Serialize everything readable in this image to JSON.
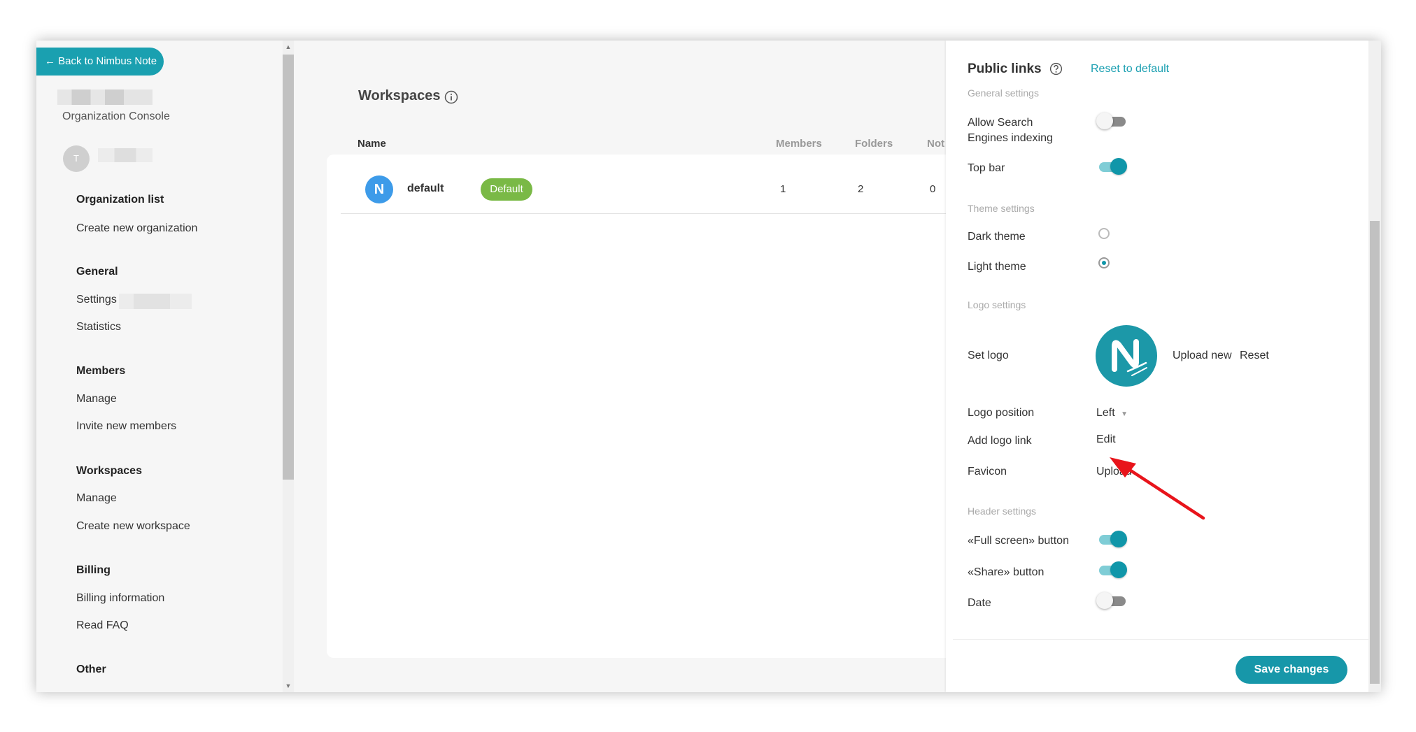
{
  "sidebar": {
    "back_label": "Back to Nimbus Note",
    "console_label": "Organization Console",
    "avatar_initial": "T",
    "sections": [
      {
        "title": "Organization list",
        "items": [
          "Create new organization"
        ]
      },
      {
        "title": "General",
        "items": [
          "Settings",
          "Statistics"
        ]
      },
      {
        "title": "Members",
        "items": [
          "Manage",
          "Invite new members"
        ]
      },
      {
        "title": "Workspaces",
        "items": [
          "Manage",
          "Create new workspace"
        ]
      },
      {
        "title": "Billing",
        "items": [
          "Billing information",
          "Read FAQ"
        ]
      },
      {
        "title": "Other",
        "items": []
      }
    ]
  },
  "main": {
    "title": "Workspaces",
    "columns": {
      "name": "Name",
      "members": "Members",
      "folders": "Folders",
      "notes": "Not"
    },
    "rows": [
      {
        "initial": "N",
        "name": "default",
        "badge": "Default",
        "members": "1",
        "folders": "2",
        "notes": "0"
      }
    ]
  },
  "panel": {
    "title": "Public links",
    "reset_label": "Reset to default",
    "general_settings": "General settings",
    "allow_search_line1": "Allow Search",
    "allow_search_line2": "Engines indexing",
    "top_bar": "Top bar",
    "theme_settings": "Theme settings",
    "dark_theme": "Dark theme",
    "light_theme": "Light theme",
    "logo_settings": "Logo settings",
    "set_logo": "Set logo",
    "upload_new": "Upload new",
    "reset": "Reset",
    "logo_position": "Logo position",
    "logo_position_value": "Left",
    "add_logo_link": "Add logo link",
    "edit": "Edit",
    "favicon": "Favicon",
    "upload": "Upload",
    "header_settings": "Header settings",
    "full_screen_button": "«Full screen» button",
    "share_button": "«Share» button",
    "date": "Date",
    "save_label": "Save changes",
    "toggles": {
      "allow_search": false,
      "top_bar": true,
      "full_screen": true,
      "share": true,
      "date": false
    },
    "theme_selected": "light"
  },
  "colors": {
    "accent": "#1a9fb1",
    "badge": "#7ab946",
    "annotation_arrow": "#e8141b"
  },
  "icons": [
    "arrow-left-icon",
    "info-icon",
    "help-icon",
    "caret-down-icon",
    "nimbus-logo-icon"
  ]
}
